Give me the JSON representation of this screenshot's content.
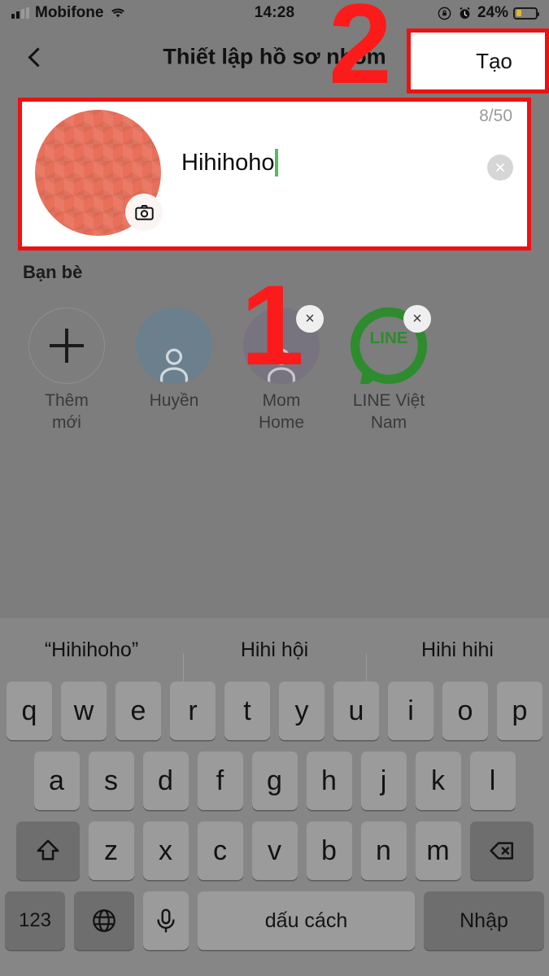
{
  "status_bar": {
    "carrier": "Mobifone",
    "time": "14:28",
    "battery_percent": "24%",
    "icons": [
      "signal-bars-icon",
      "wifi-icon",
      "rotation-lock-icon",
      "alarm-clock-icon",
      "battery-icon"
    ]
  },
  "nav": {
    "back_icon": "back-chevron-icon",
    "title": "Thiết lập hồ sơ nhóm",
    "create_label": "Tạo"
  },
  "profile": {
    "avatar_color": "#e8705a",
    "camera_icon": "camera-icon",
    "group_name": "Hihihoho",
    "char_counter": "8/50",
    "clear_icon": "close-circle-icon",
    "caret_color": "#54bb62"
  },
  "friends": {
    "section_label": "Bạn bè",
    "items": [
      {
        "name": "Thêm\nmới",
        "name_line1": "Thêm",
        "name_line2": "mới",
        "type": "add",
        "avatar_color": "transparent",
        "removable": false
      },
      {
        "name": "Huyền",
        "name_line1": "Huyền",
        "name_line2": "",
        "type": "placeholder",
        "avatar_color": "#6b7f8d",
        "removable": false
      },
      {
        "name": "Mom Home",
        "name_line1": "Mom",
        "name_line2": "Home",
        "type": "placeholder",
        "avatar_color": "#77737f",
        "removable": true,
        "remove_label": "×"
      },
      {
        "name": "LINE Việt Nam",
        "name_line1": "LINE Việt",
        "name_line2": "Nam",
        "type": "line-logo",
        "avatar_color": "#2e8b2e",
        "removable": true,
        "remove_label": "×"
      }
    ]
  },
  "keyboard": {
    "suggestions": [
      "“Hihihoho”",
      "Hihi hội",
      "Hihi hihi"
    ],
    "row1": [
      "q",
      "w",
      "e",
      "r",
      "t",
      "y",
      "u",
      "i",
      "o",
      "p"
    ],
    "row2": [
      "a",
      "s",
      "d",
      "f",
      "g",
      "h",
      "j",
      "k",
      "l"
    ],
    "row3": [
      "z",
      "x",
      "c",
      "v",
      "b",
      "n",
      "m"
    ],
    "shift_icon": "shift-arrow-icon",
    "backspace_icon": "backspace-icon",
    "numbers_label": "123",
    "globe_icon": "globe-icon",
    "mic_icon": "microphone-icon",
    "space_label": "dấu cách",
    "enter_label": "Nhập"
  },
  "annotations": {
    "step1": "1",
    "step2": "2",
    "highlight_color": "#ee1111"
  }
}
